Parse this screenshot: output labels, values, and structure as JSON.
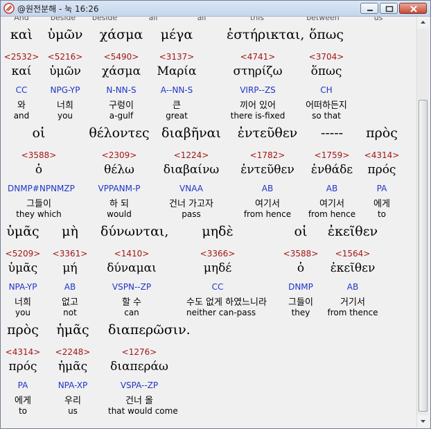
{
  "window": {
    "title": "@원전분해 - 눅 16:26"
  },
  "cut_row": [
    "And",
    "beside",
    "beside",
    "all",
    "all",
    "this",
    "between",
    "us"
  ],
  "rows": [
    [
      {
        "greek": "καὶ",
        "strong": "<2532>",
        "lemma": "καί",
        "parsing": "CC",
        "korean": "와",
        "english": "and"
      },
      {
        "greek": "ὑμῶν",
        "strong": "<5216>",
        "lemma": "ὑμῶν",
        "parsing": "NPG-YP",
        "korean": "너희",
        "english": "you"
      },
      {
        "greek": "χάσμα",
        "strong": "<5490>",
        "lemma": "χάσμα",
        "parsing": "N-NN-S",
        "korean": "구렁이",
        "english": "a-gulf"
      },
      {
        "greek": "μέγα",
        "strong": "<3137>",
        "lemma": "Μαρία",
        "parsing": "A--NN-S",
        "korean": "큰",
        "english": "great"
      },
      {
        "greek": "ἐστήρικται,",
        "strong": "<4741>",
        "lemma": "στηρίζω",
        "parsing": "VIRP--ZS",
        "korean": "끼어 있어",
        "english": "there is-fixed"
      },
      {
        "greek": "ὅπως",
        "strong": "<3704>",
        "lemma": "ὅπως",
        "parsing": "CH",
        "korean": "어떠하든지",
        "english": "so that"
      }
    ],
    [
      {
        "greek": "οἱ",
        "strong": "<3588>",
        "lemma": "ὁ",
        "parsing": "DNMP#NPNMZP",
        "korean": "그들이",
        "english": "they which"
      },
      {
        "greek": "θέλοντες",
        "strong": "<2309>",
        "lemma": "θέλω",
        "parsing": "VPPANM-P",
        "korean": "하 되",
        "english": "would"
      },
      {
        "greek": "διαβῆναι",
        "strong": "<1224>",
        "lemma": "διαβαίνω",
        "parsing": "VNAA",
        "korean": "건너 가고자",
        "english": "pass"
      },
      {
        "greek": "ἐντεῦθεν",
        "strong": "<1782>",
        "lemma": "ἐντεῦθεν",
        "parsing": "AB",
        "korean": "여기서",
        "english": "from hence"
      },
      {
        "greek": "-----",
        "strong": "<1759>",
        "lemma": "ἐνθάδε",
        "parsing": "AB",
        "korean": "여기서",
        "english": "from hence"
      },
      {
        "greek": "πρὸς",
        "strong": "<4314>",
        "lemma": "πρός",
        "parsing": "PA",
        "korean": "에게",
        "english": "to"
      }
    ],
    [
      {
        "greek": "ὑμᾶς",
        "strong": "<5209>",
        "lemma": "ὑμᾶς",
        "parsing": "NPA-YP",
        "korean": "너희",
        "english": "you"
      },
      {
        "greek": "μὴ",
        "strong": "<3361>",
        "lemma": "μή",
        "parsing": "AB",
        "korean": "없고",
        "english": "not"
      },
      {
        "greek": "δύνωνται,",
        "strong": "<1410>",
        "lemma": "δύναμαι",
        "parsing": "VSPN--ZP",
        "korean": "할 수",
        "english": "can"
      },
      {
        "greek": "μηδὲ",
        "strong": "<3366>",
        "lemma": "μηδέ",
        "parsing": "CC",
        "korean": "수도 없게 하였느니라",
        "english": "neither can-pass"
      },
      {
        "greek": "οἱ",
        "strong": "<3588>",
        "lemma": "ὁ",
        "parsing": "DNMP",
        "korean": "그들이",
        "english": "they"
      },
      {
        "greek": "ἐκεῖθεν",
        "strong": "<1564>",
        "lemma": "ἐκεῖθεν",
        "parsing": "AB",
        "korean": "거기서",
        "english": "from thence"
      }
    ],
    [
      {
        "greek": "πρὸς",
        "strong": "<4314>",
        "lemma": "πρός",
        "parsing": "PA",
        "korean": "에게",
        "english": "to"
      },
      {
        "greek": "ἡμᾶς",
        "strong": "<2248>",
        "lemma": "ἡμᾶς",
        "parsing": "NPA-XP",
        "korean": "우리",
        "english": "us"
      },
      {
        "greek": "διαπερῶσιν.",
        "strong": "<1276>",
        "lemma": "διαπεράω",
        "parsing": "VSPA--ZP",
        "korean": "건너 올",
        "english": "that would come"
      }
    ]
  ]
}
